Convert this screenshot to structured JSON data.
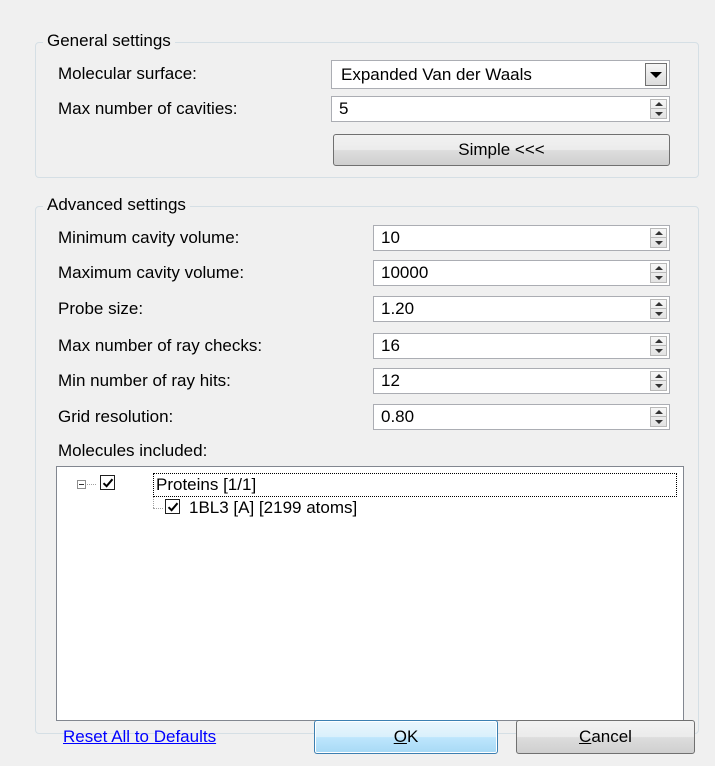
{
  "general": {
    "title": "General settings",
    "molecular_surface_label": "Molecular surface:",
    "molecular_surface_value": "Expanded Van der Waals",
    "max_cavities_label": "Max number of cavities:",
    "max_cavities_value": "5",
    "simple_button": "Simple <<<"
  },
  "advanced": {
    "title": "Advanced settings",
    "fields": [
      {
        "label": "Minimum cavity volume:",
        "value": "10"
      },
      {
        "label": "Maximum cavity volume:",
        "value": "10000"
      },
      {
        "label": "Probe size:",
        "value": "1.20"
      },
      {
        "label": "Max number of ray checks:",
        "value": "16"
      },
      {
        "label": "Min number of ray hits:",
        "value": "12"
      },
      {
        "label": "Grid resolution:",
        "value": "0.80"
      }
    ],
    "molecules_label": "Molecules included:",
    "tree": {
      "root": {
        "label": "Proteins [1/1]",
        "checked": true
      },
      "child": {
        "label": "1BL3 [A] [2199 atoms]",
        "checked": true
      }
    }
  },
  "footer": {
    "reset_link": "Reset All to Defaults",
    "ok_button": "OK",
    "cancel_button": "Cancel"
  }
}
